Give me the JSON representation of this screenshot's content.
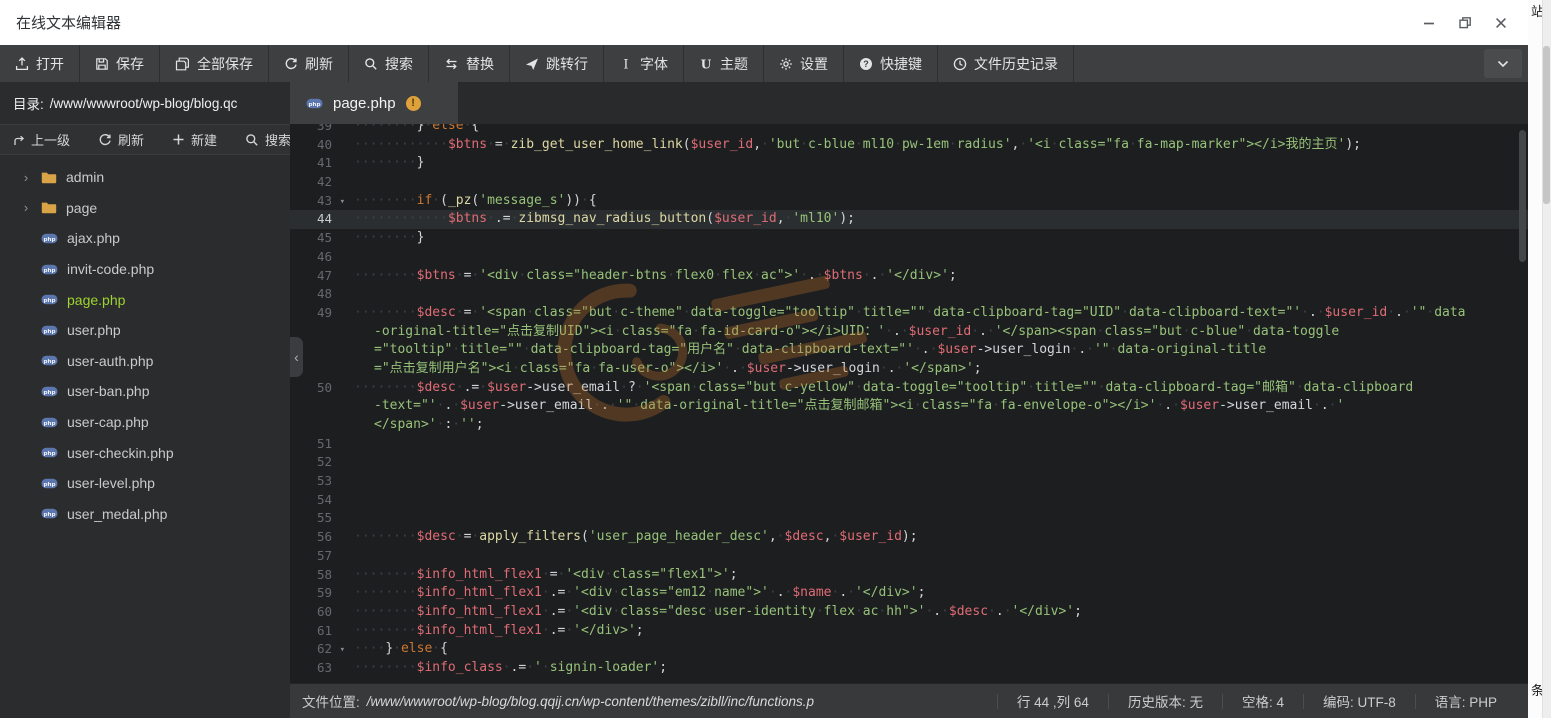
{
  "window": {
    "title": "在线文本编辑器"
  },
  "icons": {
    "modified": "!",
    "fold": "▾",
    "tree_chevron": "›",
    "collapse": "‹"
  },
  "toolbar": {
    "items": [
      {
        "id": "open",
        "icon": "open",
        "label": "打开"
      },
      {
        "id": "save",
        "icon": "save",
        "label": "保存"
      },
      {
        "id": "save-all",
        "icon": "save-all",
        "label": "全部保存"
      },
      {
        "id": "refresh",
        "icon": "refresh",
        "label": "刷新"
      },
      {
        "id": "search",
        "icon": "search",
        "label": "搜索"
      },
      {
        "id": "replace",
        "icon": "replace",
        "label": "替换"
      },
      {
        "id": "goto-line",
        "icon": "goto",
        "label": "跳转行"
      },
      {
        "id": "font",
        "icon": "font",
        "label": "字体"
      },
      {
        "id": "theme",
        "icon": "theme",
        "label": "主题"
      },
      {
        "id": "settings",
        "icon": "settings",
        "label": "设置"
      },
      {
        "id": "shortcuts",
        "icon": "shortcut",
        "label": "快捷键"
      },
      {
        "id": "file-history",
        "icon": "history",
        "label": "文件历史记录"
      }
    ]
  },
  "sidebar": {
    "dir_label": "目录:",
    "dir_path": "/www/wwwroot/wp-blog/blog.qc",
    "actions": [
      {
        "id": "up-level",
        "icon": "up",
        "label": "上一级"
      },
      {
        "id": "refresh",
        "icon": "refresh",
        "label": "刷新"
      },
      {
        "id": "new",
        "icon": "plus",
        "label": "新建"
      },
      {
        "id": "search",
        "icon": "search",
        "label": "搜索"
      }
    ],
    "tree": [
      {
        "type": "folder",
        "name": "admin"
      },
      {
        "type": "folder",
        "name": "page"
      },
      {
        "type": "file",
        "name": "ajax.php"
      },
      {
        "type": "file",
        "name": "invit-code.php"
      },
      {
        "type": "file",
        "name": "page.php",
        "active": true
      },
      {
        "type": "file",
        "name": "user.php"
      },
      {
        "type": "file",
        "name": "user-auth.php"
      },
      {
        "type": "file",
        "name": "user-ban.php"
      },
      {
        "type": "file",
        "name": "user-cap.php"
      },
      {
        "type": "file",
        "name": "user-checkin.php"
      },
      {
        "type": "file",
        "name": "user-level.php"
      },
      {
        "type": "file",
        "name": "user_medal.php"
      }
    ]
  },
  "tabs": [
    {
      "label": "page.php",
      "modified": true,
      "active": true
    }
  ],
  "editor": {
    "rows": [
      {
        "no": "39",
        "segs": [
          [
            "p",
            "        } "
          ],
          [
            "k",
            "else"
          ],
          [
            "p",
            " {"
          ]
        ]
      },
      {
        "no": "40",
        "segs": [
          [
            "p",
            "            "
          ],
          [
            "v",
            "$btns"
          ],
          [
            "p",
            " = "
          ],
          [
            "f",
            "zib_get_user_home_link"
          ],
          [
            "p",
            "("
          ],
          [
            "v",
            "$user_id"
          ],
          [
            "p",
            ", "
          ],
          [
            "s",
            "'but c-blue ml10 pw-1em radius'"
          ],
          [
            "p",
            ", "
          ],
          [
            "s",
            "'<i class=\"fa fa-map-marker\"></i>我的主页'"
          ],
          [
            "p",
            ");"
          ]
        ]
      },
      {
        "no": "41",
        "segs": [
          [
            "p",
            "        }"
          ]
        ]
      },
      {
        "no": "42",
        "segs": []
      },
      {
        "no": "43",
        "fold": true,
        "segs": [
          [
            "p",
            "        "
          ],
          [
            "k",
            "if"
          ],
          [
            "p",
            " ("
          ],
          [
            "f",
            "_pz"
          ],
          [
            "p",
            "("
          ],
          [
            "s",
            "'message_s'"
          ],
          [
            "p",
            ")) {"
          ]
        ]
      },
      {
        "no": "44",
        "cur": true,
        "segs": [
          [
            "p",
            "            "
          ],
          [
            "v",
            "$btns"
          ],
          [
            "p",
            " .= "
          ],
          [
            "f",
            "zibmsg_nav_radius_button"
          ],
          [
            "p",
            "("
          ],
          [
            "v",
            "$user_id"
          ],
          [
            "p",
            ", "
          ],
          [
            "s",
            "'ml10'"
          ],
          [
            "p",
            ");"
          ]
        ]
      },
      {
        "no": "45",
        "segs": [
          [
            "p",
            "        }"
          ]
        ]
      },
      {
        "no": "46",
        "segs": []
      },
      {
        "no": "47",
        "segs": [
          [
            "p",
            "        "
          ],
          [
            "v",
            "$btns"
          ],
          [
            "p",
            " = "
          ],
          [
            "s",
            "'<div class=\"header-btns flex0 flex ac\">'"
          ],
          [
            "p",
            " . "
          ],
          [
            "v",
            "$btns"
          ],
          [
            "p",
            " . "
          ],
          [
            "s",
            "'</div>'"
          ],
          [
            "p",
            ";"
          ]
        ]
      },
      {
        "no": "48",
        "segs": []
      },
      {
        "no": "49",
        "segs": [
          [
            "p",
            "        "
          ],
          [
            "v",
            "$desc"
          ],
          [
            "p",
            " = "
          ],
          [
            "s",
            "'<span class=\"but c-theme\" data-toggle=\"tooltip\" title=\"\" data-clipboard-tag=\"UID\" data-clipboard-text=\"'"
          ],
          [
            "p",
            " . "
          ],
          [
            "v",
            "$user_id"
          ],
          [
            "p",
            " . "
          ],
          [
            "s",
            "'\" data"
          ]
        ]
      },
      {
        "cont": true,
        "segs": [
          [
            "s",
            "-original-title=\"点击复制UID\"><i class=\"fa fa-id-card-o\"></i>UID：'"
          ],
          [
            "p",
            " . "
          ],
          [
            "v",
            "$user_id"
          ],
          [
            "p",
            " . "
          ],
          [
            "s",
            "'</span><span class=\"but c-blue\" data-toggle"
          ]
        ]
      },
      {
        "cont": true,
        "segs": [
          [
            "s",
            "=\"tooltip\" title=\"\" data-clipboard-tag=\"用户名\" data-clipboard-text=\"'"
          ],
          [
            "p",
            " . "
          ],
          [
            "v",
            "$user"
          ],
          [
            "p",
            "->user_login"
          ],
          [
            "p",
            " . "
          ],
          [
            "s",
            "'\" data-original-title"
          ]
        ]
      },
      {
        "cont": true,
        "segs": [
          [
            "s",
            "=\"点击复制用户名\"><i class=\"fa fa-user-o\"></i>'"
          ],
          [
            "p",
            " . "
          ],
          [
            "v",
            "$user"
          ],
          [
            "p",
            "->user_login"
          ],
          [
            "p",
            " . "
          ],
          [
            "s",
            "'</span>'"
          ],
          [
            "p",
            ";"
          ]
        ]
      },
      {
        "no": "50",
        "segs": [
          [
            "p",
            "        "
          ],
          [
            "v",
            "$desc"
          ],
          [
            "p",
            " .= "
          ],
          [
            "v",
            "$user"
          ],
          [
            "p",
            "->user_email"
          ],
          [
            "p",
            " ? "
          ],
          [
            "s",
            "'<span class=\"but c-yellow\" data-toggle=\"tooltip\" title=\"\" data-clipboard-tag=\"邮箱\" data-clipboard"
          ]
        ]
      },
      {
        "cont": true,
        "segs": [
          [
            "s",
            "-text=\"'"
          ],
          [
            "p",
            " . "
          ],
          [
            "v",
            "$user"
          ],
          [
            "p",
            "->user_email"
          ],
          [
            "p",
            " . "
          ],
          [
            "s",
            "'\" data-original-title=\"点击复制邮箱\"><i class=\"fa fa-envelope-o\"></i>'"
          ],
          [
            "p",
            " . "
          ],
          [
            "v",
            "$user"
          ],
          [
            "p",
            "->user_email"
          ],
          [
            "p",
            " . "
          ],
          [
            "s",
            "'"
          ]
        ]
      },
      {
        "cont": true,
        "segs": [
          [
            "s",
            "</span>'"
          ],
          [
            "p",
            " : "
          ],
          [
            "s",
            "''"
          ],
          [
            "p",
            ";"
          ]
        ]
      },
      {
        "no": "51",
        "segs": []
      },
      {
        "no": "52",
        "segs": []
      },
      {
        "no": "53",
        "segs": []
      },
      {
        "no": "54",
        "segs": []
      },
      {
        "no": "55",
        "segs": []
      },
      {
        "no": "56",
        "segs": [
          [
            "p",
            "        "
          ],
          [
            "v",
            "$desc"
          ],
          [
            "p",
            " = "
          ],
          [
            "f",
            "apply_filters"
          ],
          [
            "p",
            "("
          ],
          [
            "s",
            "'user_page_header_desc'"
          ],
          [
            "p",
            ", "
          ],
          [
            "v",
            "$desc"
          ],
          [
            "p",
            ", "
          ],
          [
            "v",
            "$user_id"
          ],
          [
            "p",
            ");"
          ]
        ]
      },
      {
        "no": "57",
        "segs": []
      },
      {
        "no": "58",
        "segs": [
          [
            "p",
            "        "
          ],
          [
            "v",
            "$info_html_flex1"
          ],
          [
            "p",
            " = "
          ],
          [
            "s",
            "'<div class=\"flex1\">'"
          ],
          [
            "p",
            ";"
          ]
        ]
      },
      {
        "no": "59",
        "segs": [
          [
            "p",
            "        "
          ],
          [
            "v",
            "$info_html_flex1"
          ],
          [
            "p",
            " .= "
          ],
          [
            "s",
            "'<div class=\"em12 name\">'"
          ],
          [
            "p",
            " . "
          ],
          [
            "v",
            "$name"
          ],
          [
            "p",
            " . "
          ],
          [
            "s",
            "'</div>'"
          ],
          [
            "p",
            ";"
          ]
        ]
      },
      {
        "no": "60",
        "segs": [
          [
            "p",
            "        "
          ],
          [
            "v",
            "$info_html_flex1"
          ],
          [
            "p",
            " .= "
          ],
          [
            "s",
            "'<div class=\"desc user-identity flex ac hh\">'"
          ],
          [
            "p",
            " . "
          ],
          [
            "v",
            "$desc"
          ],
          [
            "p",
            " . "
          ],
          [
            "s",
            "'</div>'"
          ],
          [
            "p",
            ";"
          ]
        ]
      },
      {
        "no": "61",
        "segs": [
          [
            "p",
            "        "
          ],
          [
            "v",
            "$info_html_flex1"
          ],
          [
            "p",
            " .= "
          ],
          [
            "s",
            "'</div>'"
          ],
          [
            "p",
            ";"
          ]
        ]
      },
      {
        "no": "62",
        "fold": true,
        "segs": [
          [
            "p",
            "    } "
          ],
          [
            "k",
            "else"
          ],
          [
            "p",
            " {"
          ]
        ]
      },
      {
        "no": "63",
        "segs": [
          [
            "p",
            "        "
          ],
          [
            "v",
            "$info_class"
          ],
          [
            "p",
            " .= "
          ],
          [
            "s",
            "' signin-loader'"
          ],
          [
            "p",
            ";"
          ]
        ]
      }
    ]
  },
  "statusbar": {
    "file_location_label": "文件位置:",
    "file_location": "/www/wwwroot/wp-blog/blog.qqij.cn/wp-content/themes/zibll/inc/functions.p",
    "items": [
      "行 44 ,列 64",
      "历史版本:  无",
      "空格:  4",
      "编码:  UTF-8",
      "语言:  PHP"
    ]
  },
  "page_behind": {
    "top_char": "站",
    "bottom_char": "条"
  },
  "colors": {
    "active_file_green": "#9ed42f",
    "string_green": "#97c279",
    "variable_red": "#e06c75",
    "keyword_orange": "#cc7832",
    "modified_yellow": "#dfa23b",
    "watermark_orange": "#c8742d"
  }
}
